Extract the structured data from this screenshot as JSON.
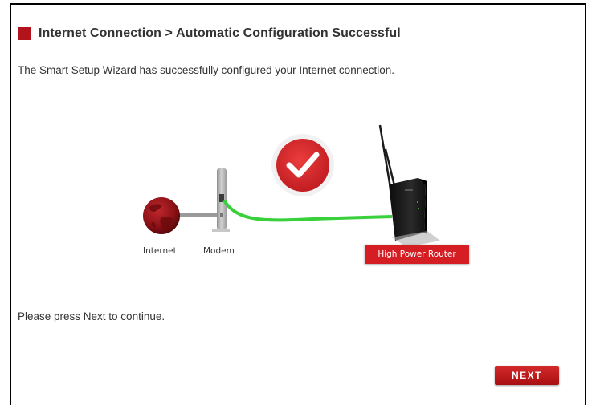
{
  "header": {
    "title": "Internet Connection > Automatic Configuration Successful"
  },
  "main": {
    "description": "The Smart Setup Wizard has successfully configured your Internet connection.",
    "continue_text": "Please press Next to continue."
  },
  "diagram": {
    "internet_label": "Internet",
    "modem_label": "Modem",
    "router_label": "High Power Router",
    "status_icon": "check-icon"
  },
  "footer": {
    "next_label": "NEXT"
  },
  "colors": {
    "accent_red": "#b3141b",
    "connection_green": "#39d13b",
    "router_label_bg": "#d51e24"
  }
}
